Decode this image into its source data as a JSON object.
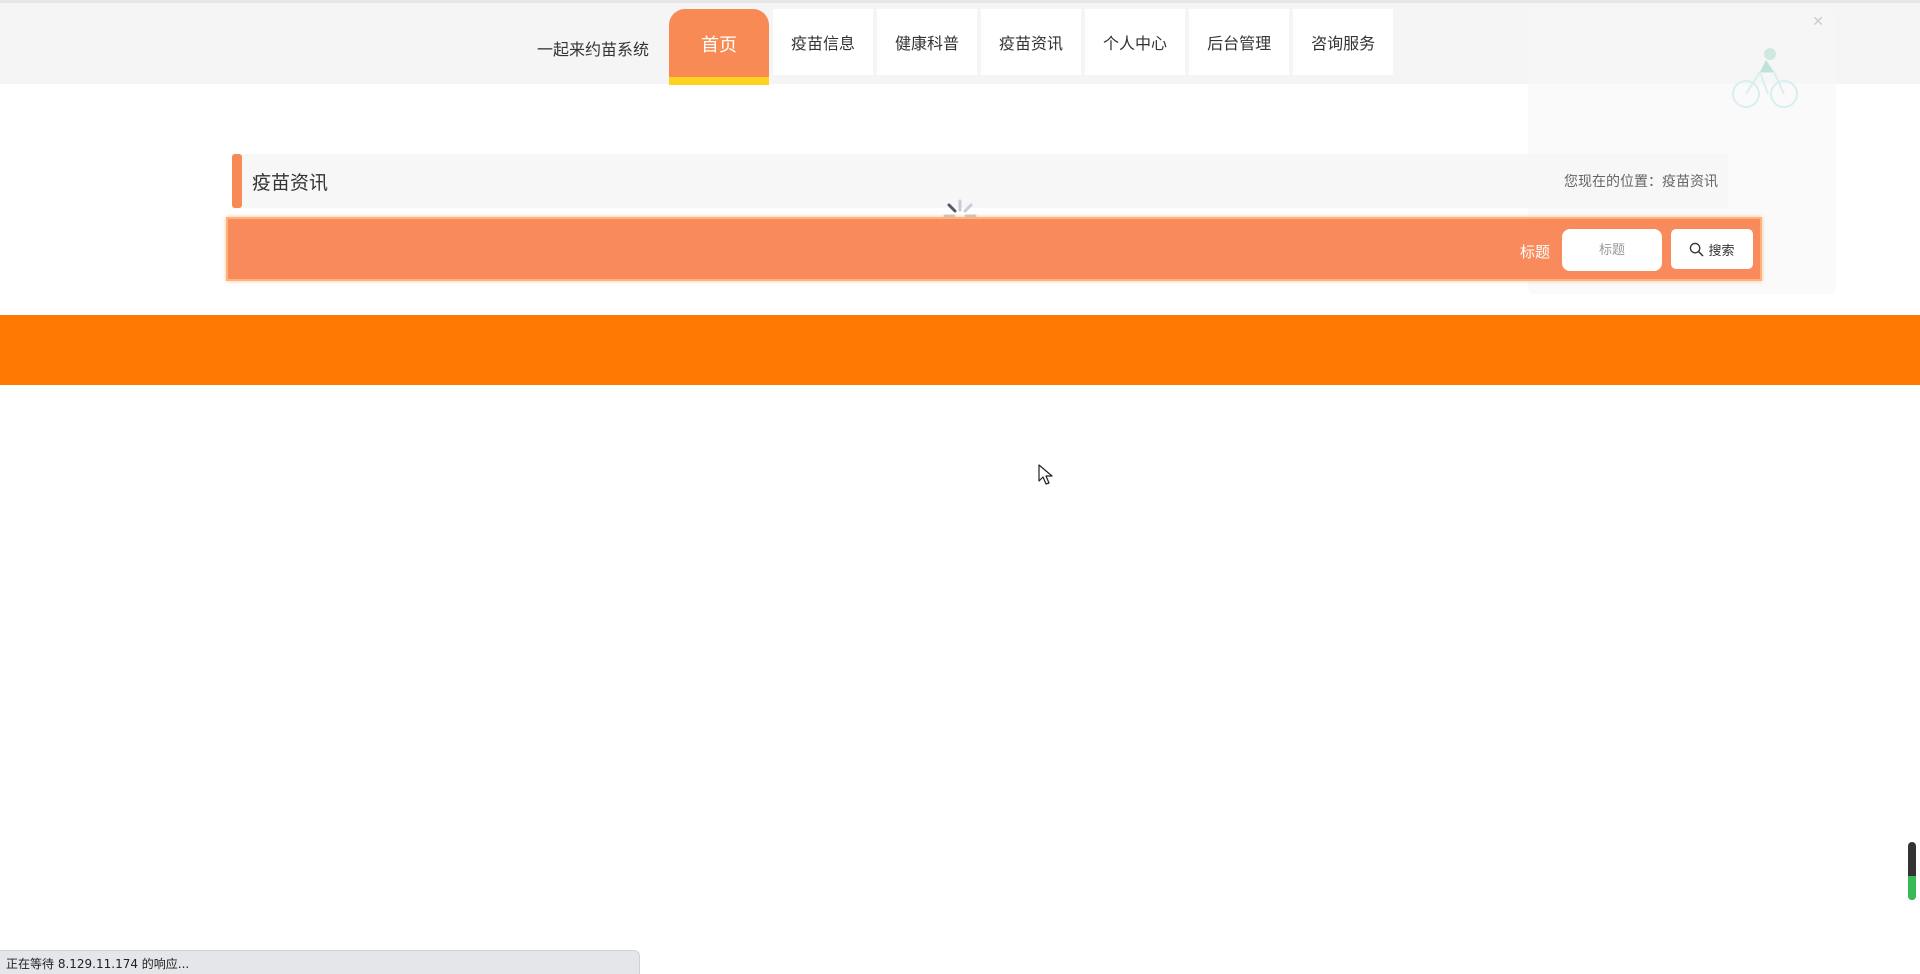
{
  "header": {
    "brand": "一起来约苗系统",
    "nav": [
      {
        "label": "首页",
        "active": true
      },
      {
        "label": "疫苗信息"
      },
      {
        "label": "健康科普"
      },
      {
        "label": "疫苗资讯"
      },
      {
        "label": "个人中心"
      },
      {
        "label": "后台管理"
      },
      {
        "label": "咨询服务"
      }
    ]
  },
  "section": {
    "title": "疫苗资讯",
    "breadcrumb": "您现在的位置：疫苗资讯"
  },
  "search": {
    "label": "标题",
    "placeholder": "标题",
    "button_label": "搜索"
  },
  "status_bar": {
    "text": "正在等待 8.129.11.174 的响应..."
  },
  "colors": {
    "accent": "#f88a56",
    "highlight": "#ffd21e",
    "band": "#ff7a03",
    "search_strip": "#f88a5c"
  },
  "icons": {
    "search": "search-icon",
    "spinner": "loading-spinner-icon",
    "cursor": "mouse-cursor-icon"
  }
}
